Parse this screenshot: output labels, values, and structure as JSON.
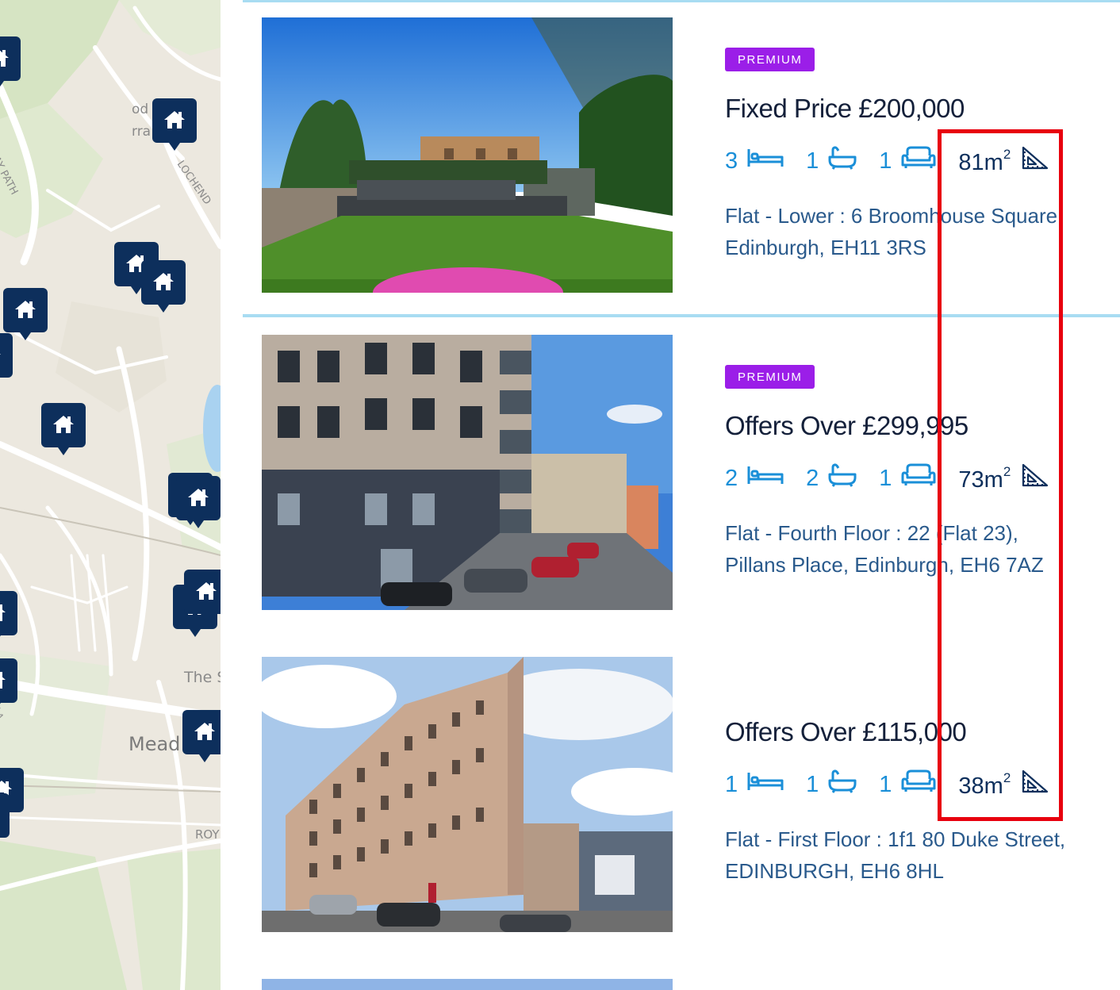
{
  "map": {
    "labels": [
      "RAILWAY PATH",
      "LOCHEND",
      "od",
      "rra",
      "The S",
      "Mead",
      "ROY",
      "LA"
    ],
    "pin_count": 16,
    "pin_icon": "house-icon"
  },
  "listings": [
    {
      "badge": "PREMIUM",
      "price": "Fixed Price £200,000",
      "beds": "3",
      "baths": "1",
      "receptions": "1",
      "area": "81m",
      "area_unit_sup": "2",
      "address": "Flat - Lower : 6 Broomhouse Square, Edinburgh, EH11 3RS",
      "photo": "garden"
    },
    {
      "badge": "PREMIUM",
      "price": "Offers Over £299,995",
      "beds": "2",
      "baths": "2",
      "receptions": "1",
      "area": "73m",
      "area_unit_sup": "2",
      "address": "Flat - Fourth Floor : 22 (Flat 23), Pillans Place, Edinburgh, EH6 7AZ",
      "photo": "modern-block"
    },
    {
      "badge": "",
      "price": "Offers Over £115,000",
      "beds": "1",
      "baths": "1",
      "receptions": "1",
      "area": "38m",
      "area_unit_sup": "2",
      "address": "Flat - First Floor : 1f1 80 Duke Street, EDINBURGH, EH6 8HL",
      "photo": "tenement"
    }
  ],
  "icons": {
    "bed": "bed-icon",
    "bath": "bath-icon",
    "reception": "sofa-icon",
    "area": "set-square-icon"
  },
  "colors": {
    "badge": "#9b1ee8",
    "price_text": "#14203a",
    "stat_icons": "#1a8fd8",
    "area_text": "#0d2f5c",
    "address_text": "#2a5a8c",
    "separator": "#a8dcf2",
    "pin": "#0d2f5c",
    "highlight": "#e8000e"
  }
}
